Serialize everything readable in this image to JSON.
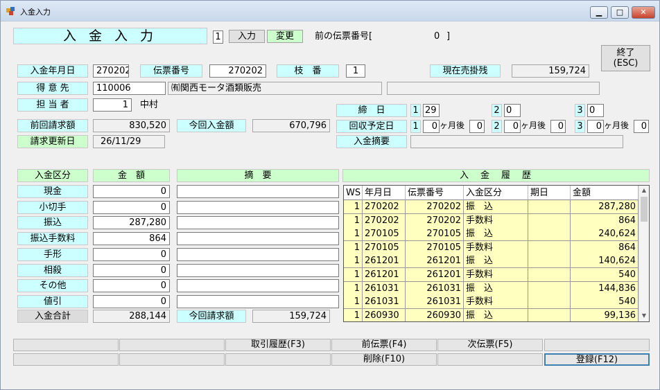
{
  "window": {
    "title": "入金入力",
    "btn_min": "▁",
    "btn_max": "□",
    "btn_close": "✕"
  },
  "header": {
    "title": "入 金 入 力",
    "mode_value": "1",
    "btn_input": "入力",
    "btn_change": "変更",
    "prev_slip_label": "前の伝票番号[",
    "prev_slip_value": "0",
    "prev_slip_end": "]"
  },
  "exit_button": {
    "line1": "終了",
    "line2": "(ESC)"
  },
  "form": {
    "date_label": "入金年月日",
    "date_value": "270202",
    "slip_label": "伝票番号",
    "slip_value": "270202",
    "branch_label": "枝　番",
    "branch_value": "1",
    "balance_label": "現在売掛残",
    "balance_value": "159,724",
    "customer_label": "得 意 先",
    "customer_code": "110006",
    "customer_name": "㈲関西モータ酒類販売",
    "customer_extra": "",
    "staff_label": "担 当 者",
    "staff_code": "1",
    "staff_name": "中村",
    "prev_bill_label": "前回請求額",
    "prev_bill_value": "830,520",
    "this_payment_label": "今回入金額",
    "this_payment_value": "670,796",
    "bill_update_label": "請求更新日",
    "bill_update_value": "26/11/29"
  },
  "closing": {
    "cutoff_label": "締　日",
    "cutoffs": [
      {
        "no": "1",
        "day": "29"
      },
      {
        "no": "2",
        "day": "0"
      },
      {
        "no": "3",
        "day": "0"
      }
    ],
    "collection_label": "回収予定日",
    "collections": [
      {
        "no": "1",
        "month": "0",
        "unit": "ヶ月後",
        "day": "0"
      },
      {
        "no": "2",
        "month": "0",
        "unit": "ヶ月後",
        "day": "0"
      },
      {
        "no": "3",
        "month": "0",
        "unit": "ヶ月後",
        "day": "0"
      }
    ],
    "memo_label": "入金摘要",
    "memo_value": ""
  },
  "payments": {
    "col_type": "入金区分",
    "col_amount": "金　額",
    "col_memo": "摘　要",
    "rows": [
      {
        "type": "現金",
        "amount": "0",
        "memo": ""
      },
      {
        "type": "小切手",
        "amount": "0",
        "memo": ""
      },
      {
        "type": "振込",
        "amount": "287,280",
        "memo": ""
      },
      {
        "type": "振込手数料",
        "amount": "864",
        "memo": ""
      },
      {
        "type": "手形",
        "amount": "0",
        "memo": ""
      },
      {
        "type": "相殺",
        "amount": "0",
        "memo": ""
      },
      {
        "type": "その他",
        "amount": "0",
        "memo": ""
      },
      {
        "type": "値引",
        "amount": "0",
        "memo": ""
      }
    ],
    "total_label": "入金合計",
    "total_value": "288,144",
    "bill_label": "今回請求額",
    "bill_value": "159,724"
  },
  "history": {
    "title": "入　金　履　歴",
    "headers": [
      "WS",
      "年月日",
      "伝票番号",
      "入金区分",
      "期日",
      "金額"
    ],
    "rows": [
      [
        "1",
        "270202",
        "270202",
        "振　込",
        "",
        "287,280"
      ],
      [
        "1",
        "270202",
        "270202",
        "手数料",
        "",
        "864"
      ],
      [
        "1",
        "270105",
        "270105",
        "振　込",
        "",
        "240,624"
      ],
      [
        "1",
        "270105",
        "270105",
        "手数料",
        "",
        "864"
      ],
      [
        "1",
        "261201",
        "261201",
        "振　込",
        "",
        "140,624"
      ],
      [
        "1",
        "261201",
        "261201",
        "手数料",
        "",
        "540"
      ],
      [
        "1",
        "261031",
        "261031",
        "振　込",
        "",
        "144,836"
      ],
      [
        "1",
        "261031",
        "261031",
        "手数料",
        "",
        "540"
      ],
      [
        "1",
        "260930",
        "260930",
        "振　込",
        "",
        "99,136"
      ]
    ]
  },
  "function_keys": {
    "row1": [
      "",
      "",
      "取引履歴(F3)",
      "前伝票(F4)",
      "次伝票(F5)",
      ""
    ],
    "row2": [
      "",
      "",
      "",
      "削除(F10)",
      "",
      "登録(F12)"
    ]
  },
  "icons": {
    "app": "app-icon",
    "scroll_up": "▲",
    "scroll_down": "▼"
  },
  "colors": {
    "label_cyan": "#ccffff",
    "label_green": "#ccffcc",
    "grid_yellow": "#ffffc0"
  }
}
